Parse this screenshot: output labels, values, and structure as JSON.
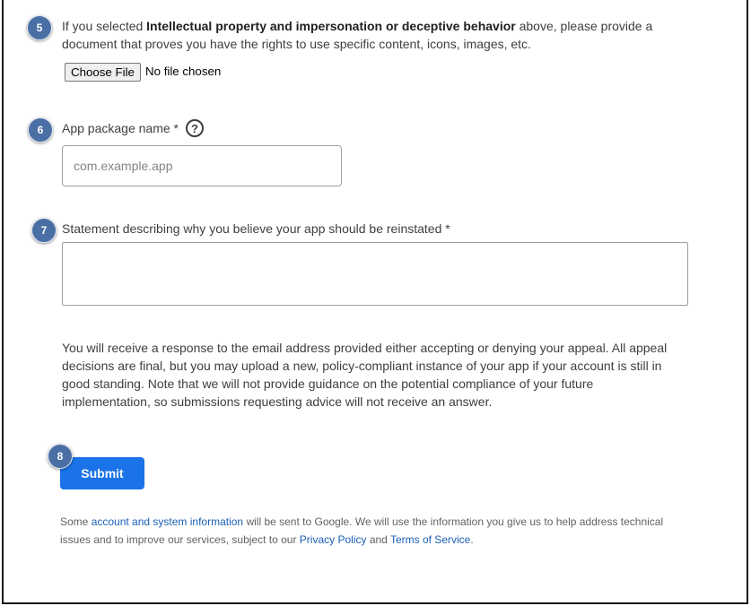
{
  "steps": {
    "s5": "5",
    "s6": "6",
    "s7": "7",
    "s8": "8"
  },
  "document_section": {
    "prefix": "If you selected ",
    "bold": "Intellectual property and impersonation or deceptive behavior",
    "suffix": " above, please provide a document that proves you have the rights to use specific content, icons, images, etc.",
    "choose_file_label": "Choose File",
    "file_status": "No file chosen"
  },
  "package_section": {
    "label": "App package name *",
    "help_glyph": "?",
    "help_icon": "question-circle-icon",
    "placeholder": "com.example.app"
  },
  "statement_section": {
    "label": "Statement describing why you believe your app should be reinstated *"
  },
  "notice": "You will receive a response to the email address provided either accepting or denying your appeal. All appeal decisions are final, but you may upload a new, policy-compliant instance of your app if your account is still in good standing. Note that we will not provide guidance on the potential compliance of your future implementation, so submissions requesting advice will not receive an answer.",
  "submit_label": "Submit",
  "footer": {
    "t1": "Some ",
    "link1": "account and system information",
    "t2": " will be sent to Google. We will use the information you give us to help address technical issues and to improve our services, subject to our ",
    "link2": "Privacy Policy",
    "t3": " and ",
    "link3": "Terms of Service",
    "t4": "."
  },
  "colors": {
    "badge": "#4a6fa5",
    "primary": "#1a73e8",
    "link": "#1a5fb4"
  }
}
